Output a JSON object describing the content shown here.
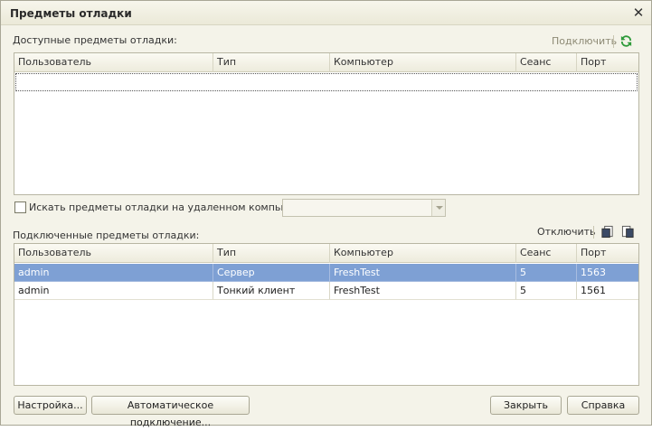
{
  "window": {
    "title": "Предметы отладки"
  },
  "available": {
    "label": "Доступные предметы отладки:",
    "connect_label": "Подключить",
    "columns": [
      "Пользователь",
      "Тип",
      "Компьютер",
      "Сеанс",
      "Порт"
    ]
  },
  "remote": {
    "checkbox_label": "Искать предметы отладки на удаленном компьютере:",
    "computer_value": ""
  },
  "connected": {
    "label": "Подключенные предметы отладки:",
    "disconnect_label": "Отключить",
    "columns": [
      "Пользователь",
      "Тип",
      "Компьютер",
      "Сеанс",
      "Порт"
    ],
    "rows": [
      [
        "admin",
        "Сервер",
        "FreshTest",
        "5",
        "1563"
      ],
      [
        "admin",
        "Тонкий клиент",
        "FreshTest",
        "5",
        "1561"
      ]
    ],
    "selected_row": 0
  },
  "buttons": {
    "settings": "Настройка...",
    "auto_connect": "Автоматическое подключение...",
    "close": "Закрыть",
    "help": "Справка"
  },
  "icons": {
    "close": "close-icon",
    "refresh": "refresh-icon",
    "expand": "expand-all-icon",
    "collapse": "collapse-all-icon"
  },
  "colors": {
    "selection": "#7ea0d4",
    "refresh": "#2e9a3a"
  }
}
